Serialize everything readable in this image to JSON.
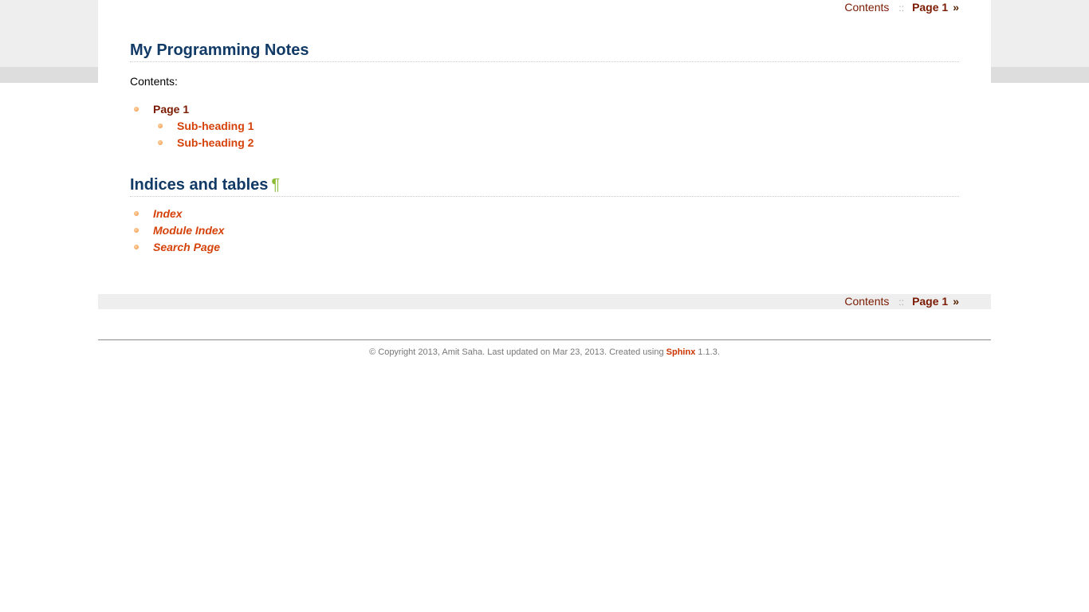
{
  "relbar": {
    "contents_label": "Contents",
    "separator": "::",
    "next_label": "Page 1",
    "next_arrow": "»"
  },
  "main": {
    "title": "My Programming Notes",
    "contents_caption": "Contents:",
    "toc": {
      "page": "Page 1",
      "subheadings": [
        "Sub-heading 1",
        "Sub-heading 2"
      ]
    },
    "indices": {
      "title": "Indices and tables",
      "headerlink": "¶",
      "items": [
        "Index",
        "Module Index",
        "Search Page"
      ]
    }
  },
  "footer": {
    "text_before": "© Copyright 2013, Amit Saha. Last updated on Mar 23, 2013. Created using ",
    "sphinx_link": "Sphinx",
    "text_after": " 1.1.3."
  },
  "colors": {
    "heading": "#113a66",
    "link": "#d5420a",
    "nav_link": "#7a1a00",
    "headerlink": "#8dbb35"
  }
}
